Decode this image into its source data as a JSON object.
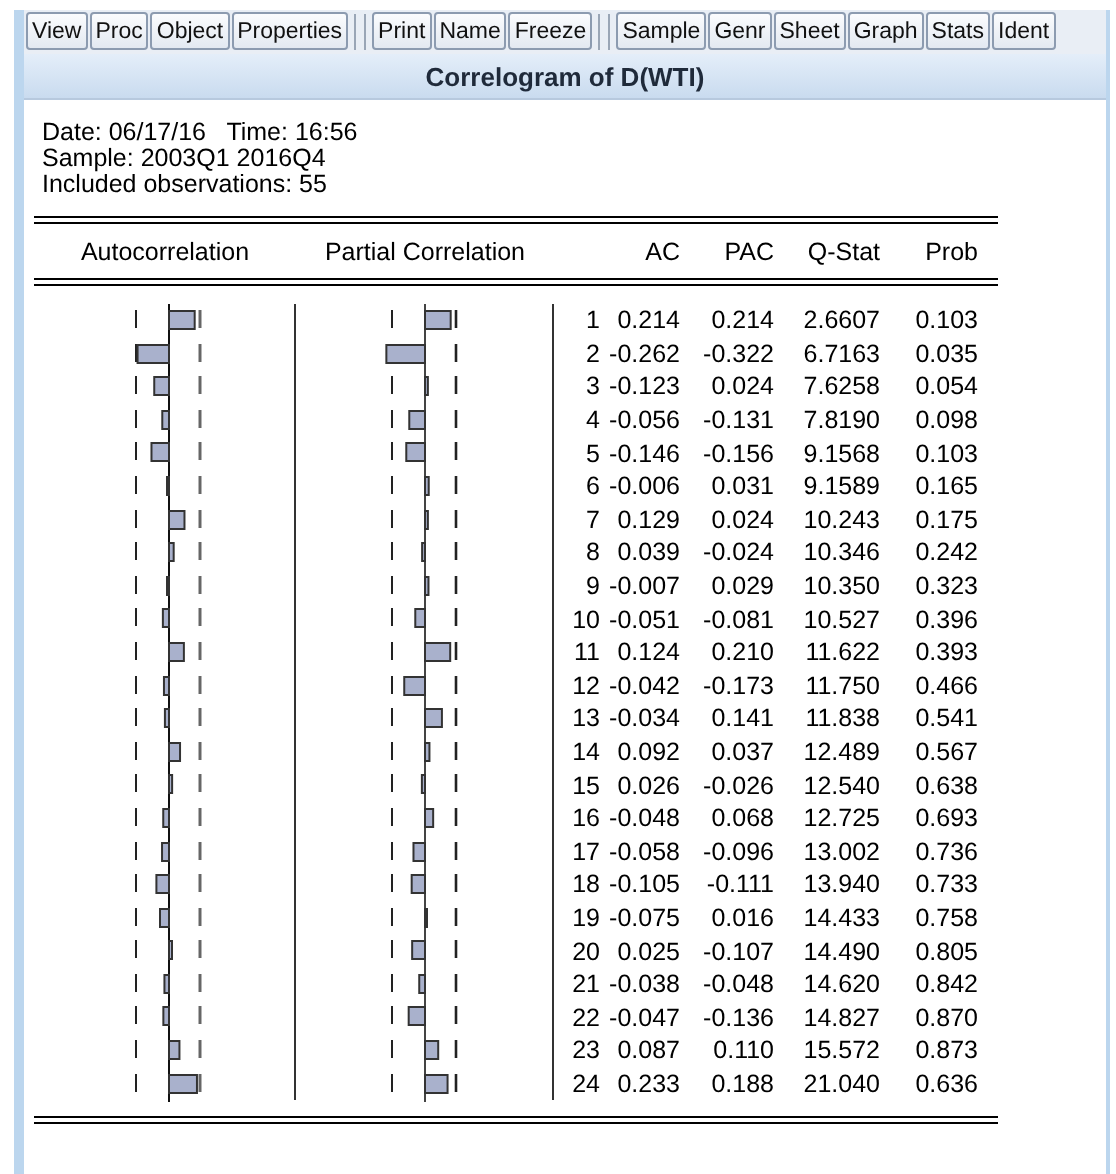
{
  "toolbar": {
    "groups": [
      [
        "View",
        "Proc",
        "Object",
        "Properties"
      ],
      [
        "Print",
        "Name",
        "Freeze"
      ],
      [
        "Sample",
        "Genr",
        "Sheet",
        "Graph",
        "Stats",
        "Ident"
      ]
    ]
  },
  "title": "Correlogram of D(WTI)",
  "info": [
    "Date: 06/17/16   Time: 16:56",
    "Sample: 2003Q1 2016Q4",
    "Included observations: 55"
  ],
  "table": {
    "columns": [
      "Autocorrelation",
      "Partial Correlation",
      "",
      "AC",
      "PAC",
      "Q-Stat",
      "Prob"
    ],
    "rows": [
      {
        "lag": "1",
        "ac": "0.214",
        "pac": "0.214",
        "q_stat": "2.6607",
        "prob": "0.103"
      },
      {
        "lag": "2",
        "ac": "-0.262",
        "pac": "-0.322",
        "q_stat": "6.7163",
        "prob": "0.035"
      },
      {
        "lag": "3",
        "ac": "-0.123",
        "pac": "0.024",
        "q_stat": "7.6258",
        "prob": "0.054"
      },
      {
        "lag": "4",
        "ac": "-0.056",
        "pac": "-0.131",
        "q_stat": "7.8190",
        "prob": "0.098"
      },
      {
        "lag": "5",
        "ac": "-0.146",
        "pac": "-0.156",
        "q_stat": "9.1568",
        "prob": "0.103"
      },
      {
        "lag": "6",
        "ac": "-0.006",
        "pac": "0.031",
        "q_stat": "9.1589",
        "prob": "0.165"
      },
      {
        "lag": "7",
        "ac": "0.129",
        "pac": "0.024",
        "q_stat": "10.243",
        "prob": "0.175"
      },
      {
        "lag": "8",
        "ac": "0.039",
        "pac": "-0.024",
        "q_stat": "10.346",
        "prob": "0.242"
      },
      {
        "lag": "9",
        "ac": "-0.007",
        "pac": "0.029",
        "q_stat": "10.350",
        "prob": "0.323"
      },
      {
        "lag": "10",
        "ac": "-0.051",
        "pac": "-0.081",
        "q_stat": "10.527",
        "prob": "0.396"
      },
      {
        "lag": "11",
        "ac": "0.124",
        "pac": "0.210",
        "q_stat": "11.622",
        "prob": "0.393"
      },
      {
        "lag": "12",
        "ac": "-0.042",
        "pac": "-0.173",
        "q_stat": "11.750",
        "prob": "0.466"
      },
      {
        "lag": "13",
        "ac": "-0.034",
        "pac": "0.141",
        "q_stat": "11.838",
        "prob": "0.541"
      },
      {
        "lag": "14",
        "ac": "0.092",
        "pac": "0.037",
        "q_stat": "12.489",
        "prob": "0.567"
      },
      {
        "lag": "15",
        "ac": "0.026",
        "pac": "-0.026",
        "q_stat": "12.540",
        "prob": "0.638"
      },
      {
        "lag": "16",
        "ac": "-0.048",
        "pac": "0.068",
        "q_stat": "12.725",
        "prob": "0.693"
      },
      {
        "lag": "17",
        "ac": "-0.058",
        "pac": "-0.096",
        "q_stat": "13.002",
        "prob": "0.736"
      },
      {
        "lag": "18",
        "ac": "-0.105",
        "pac": "-0.111",
        "q_stat": "13.940",
        "prob": "0.733"
      },
      {
        "lag": "19",
        "ac": "-0.075",
        "pac": "0.016",
        "q_stat": "14.433",
        "prob": "0.758"
      },
      {
        "lag": "20",
        "ac": "0.025",
        "pac": "-0.107",
        "q_stat": "14.490",
        "prob": "0.805"
      },
      {
        "lag": "21",
        "ac": "-0.038",
        "pac": "-0.048",
        "q_stat": "14.620",
        "prob": "0.842"
      },
      {
        "lag": "22",
        "ac": "-0.047",
        "pac": "-0.136",
        "q_stat": "14.827",
        "prob": "0.870"
      },
      {
        "lag": "23",
        "ac": "0.087",
        "pac": "0.110",
        "q_stat": "15.572",
        "prob": "0.873"
      },
      {
        "lag": "24",
        "ac": "0.233",
        "pac": "0.188",
        "q_stat": "21.040",
        "prob": "0.636"
      }
    ]
  }
}
